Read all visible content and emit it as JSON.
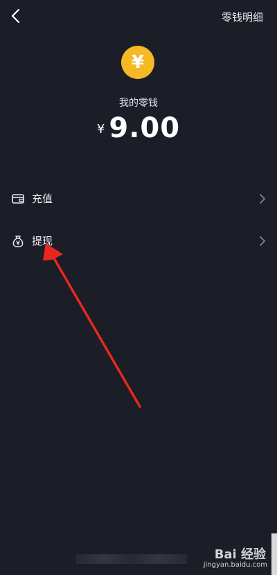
{
  "header": {
    "detail_label": "零钱明细"
  },
  "wallet": {
    "coin_symbol": "¥",
    "balance_label": "我的零钱",
    "currency": "¥",
    "amount": "9.00"
  },
  "menu": [
    {
      "label": "充值",
      "icon": "wallet-card-icon"
    },
    {
      "label": "提现",
      "icon": "money-bag-icon"
    }
  ],
  "watermark": {
    "brand": "Bai 经验",
    "url": "jingyan.baidu.com"
  },
  "colors": {
    "background": "#1b1d27",
    "coin": "#f6b824",
    "annotation": "#e8281e"
  }
}
